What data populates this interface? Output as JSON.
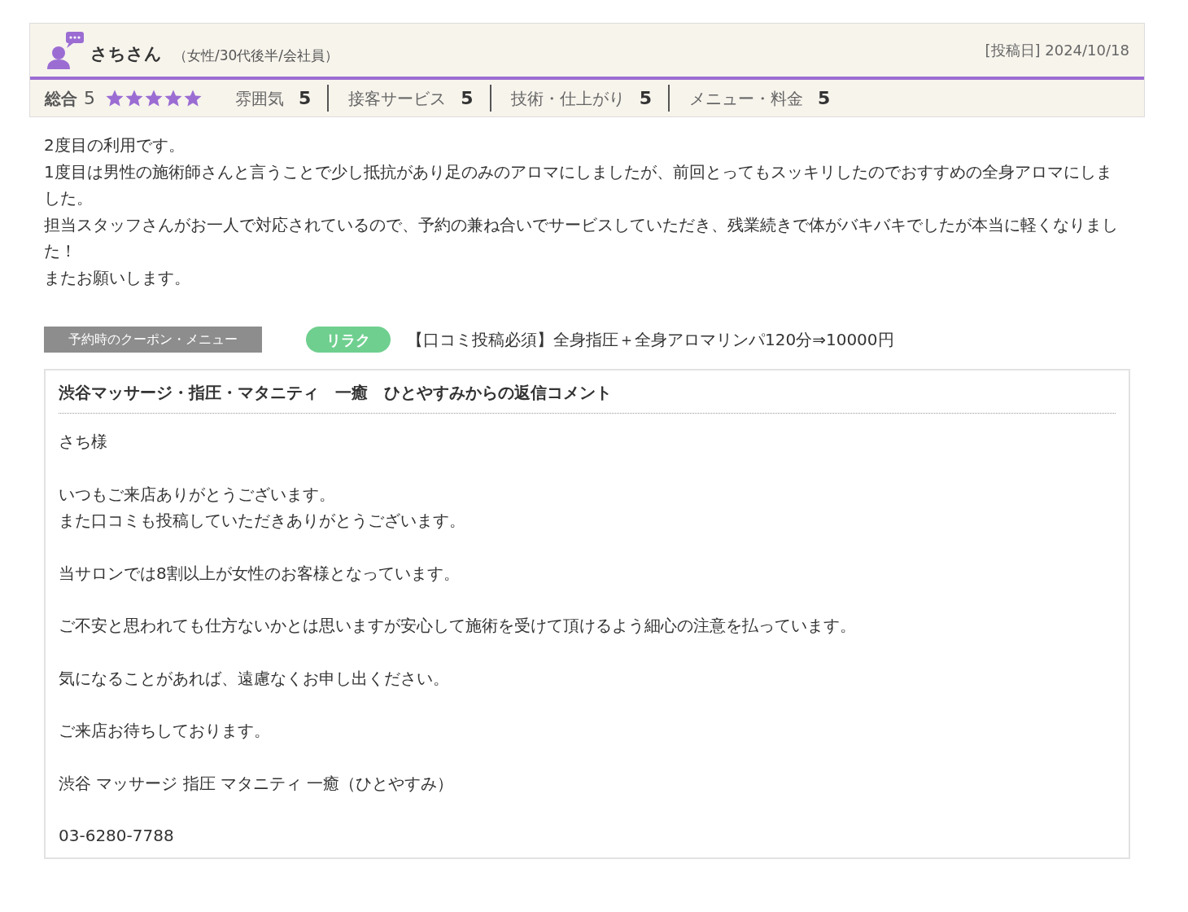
{
  "review": {
    "reviewer": "さちさん",
    "profile": "（女性/30代後半/会社員）",
    "posted": "[投稿日] 2024/10/18",
    "overall": {
      "label": "総合",
      "score": "5",
      "stars": 5
    },
    "ratings": [
      {
        "label": "雰囲気",
        "score": "5"
      },
      {
        "label": "接客サービス",
        "score": "5"
      },
      {
        "label": "技術・仕上がり",
        "score": "5"
      },
      {
        "label": "メニュー・料金",
        "score": "5"
      }
    ],
    "body": [
      "2度目の利用です。",
      "1度目は男性の施術師さんと言うことで少し抵抗があり足のみのアロマにしましたが、前回とってもスッキリしたのでおすすめの全身アロマにしました。",
      "担当スタッフさんがお一人で対応されているので、予約の兼ね合いでサービスしていただき、残業続きで体がバキバキでしたが本当に軽くなりました！",
      "またお願いします。"
    ],
    "coupon": {
      "label": "予約時のクーポン・メニュー",
      "tag": "リラク",
      "name": "【口コミ投稿必須】全身指圧＋全身アロマリンパ120分⇒10000円"
    }
  },
  "reply": {
    "title": "渋谷マッサージ・指圧・マタニティ　一癒　ひとやすみからの返信コメント",
    "paragraphs": [
      [
        "さち様"
      ],
      [
        "いつもご来店ありがとうございます。",
        "また口コミも投稿していただきありがとうございます。"
      ],
      [
        "当サロンでは8割以上が女性のお客様となっています。"
      ],
      [
        "ご不安と思われても仕方ないかとは思いますが安心して施術を受けて頂けるよう細心の注意を払っています。"
      ],
      [
        "気になることがあれば、遠慮なくお申し出ください。"
      ],
      [
        "ご来店お待ちしております。"
      ],
      [
        "渋谷 マッサージ 指圧 マタニティ 一癒（ひとやすみ）"
      ],
      [
        "03-6280-7788"
      ]
    ]
  }
}
